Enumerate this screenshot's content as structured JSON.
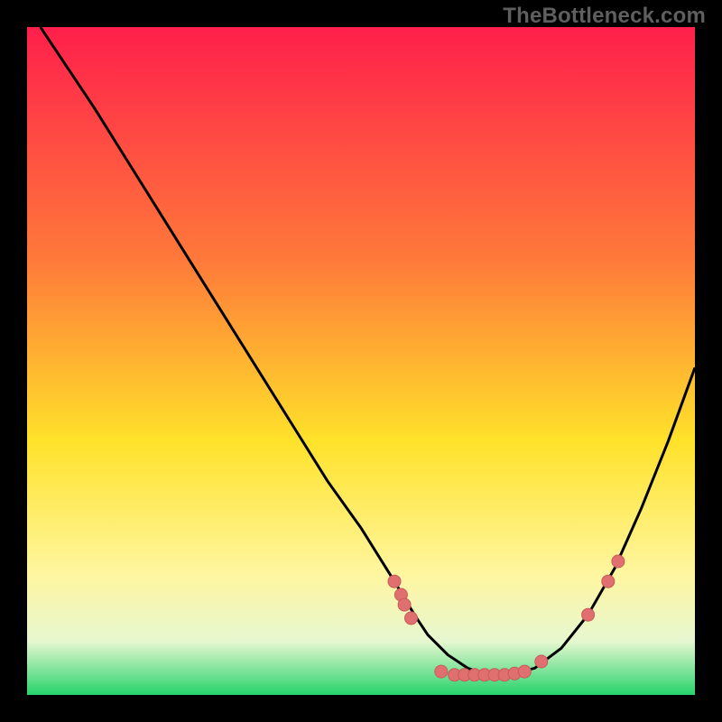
{
  "watermark": "TheBottleneck.com",
  "colors": {
    "gradient_top": "#ff1f4b",
    "gradient_mid_upper": "#ff7a3a",
    "gradient_mid": "#ffe22a",
    "gradient_lower": "#fff6a0",
    "gradient_band": "#e6f7d0",
    "gradient_bottom": "#27d36b",
    "curve": "#000000",
    "marker_fill": "#e07070",
    "marker_stroke": "#c85a5a"
  },
  "chart_data": {
    "type": "line",
    "title": "",
    "xlabel": "",
    "ylabel": "",
    "xlim": [
      0,
      100
    ],
    "ylim": [
      0,
      100
    ],
    "series": [
      {
        "name": "bottleneck-curve",
        "x": [
          2,
          6,
          10,
          15,
          20,
          25,
          30,
          35,
          40,
          45,
          50,
          55,
          58,
          60,
          63,
          66,
          69,
          72,
          76,
          80,
          84,
          88,
          92,
          96,
          100
        ],
        "y": [
          100,
          94,
          88,
          80,
          72,
          64,
          56,
          48,
          40,
          32,
          25,
          17,
          12,
          9,
          6,
          4,
          3,
          3,
          4,
          7,
          12,
          19,
          28,
          38,
          49
        ]
      }
    ],
    "markers": [
      {
        "x": 55,
        "y": 17
      },
      {
        "x": 56,
        "y": 15
      },
      {
        "x": 56.5,
        "y": 13.5
      },
      {
        "x": 57.5,
        "y": 11.5
      },
      {
        "x": 62,
        "y": 3.5
      },
      {
        "x": 64,
        "y": 3
      },
      {
        "x": 65.5,
        "y": 3
      },
      {
        "x": 67,
        "y": 3
      },
      {
        "x": 68.5,
        "y": 3
      },
      {
        "x": 70,
        "y": 3
      },
      {
        "x": 71.5,
        "y": 3
      },
      {
        "x": 73,
        "y": 3.2
      },
      {
        "x": 74.5,
        "y": 3.5
      },
      {
        "x": 77,
        "y": 5
      },
      {
        "x": 84,
        "y": 12
      },
      {
        "x": 87,
        "y": 17
      },
      {
        "x": 88.5,
        "y": 20
      }
    ]
  }
}
